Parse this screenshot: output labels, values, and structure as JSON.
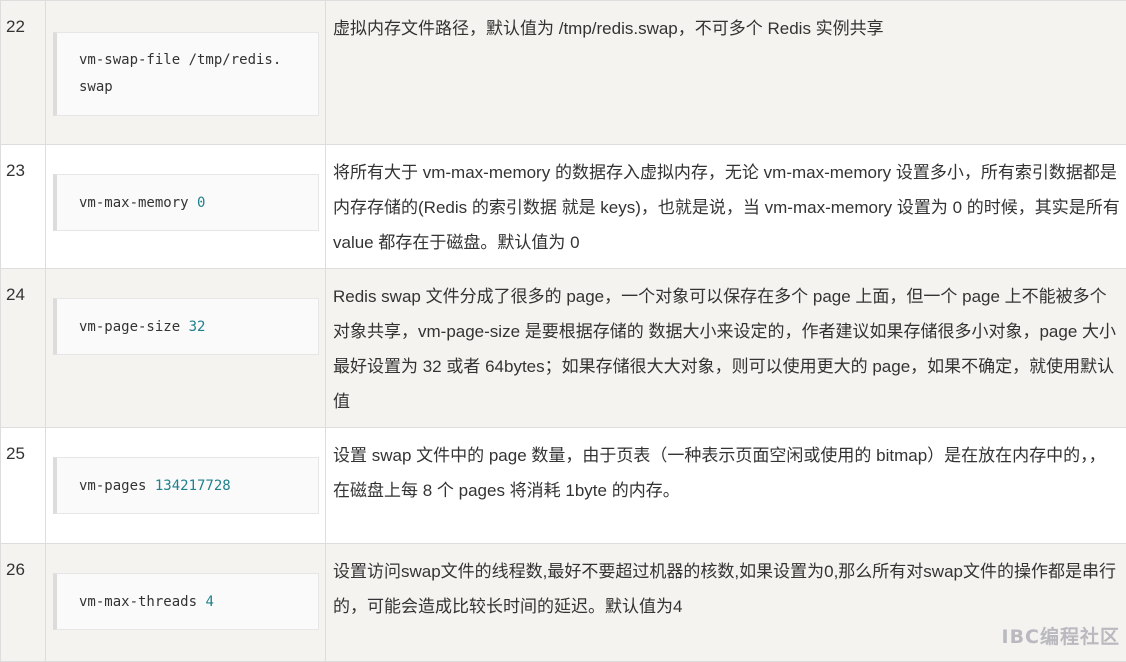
{
  "rows": [
    {
      "num": "22",
      "code_key": "vm-swap-file /tmp/redis.",
      "code_key_line2": "swap",
      "code_val": "",
      "desc": "虚拟内存文件路径，默认值为 /tmp/redis.swap，不可多个 Redis 实例共享"
    },
    {
      "num": "23",
      "code_key": "vm-max-memory ",
      "code_val": "0",
      "desc": "将所有大于 vm-max-memory 的数据存入虚拟内存，无论 vm-max-memory 设置多小，所有索引数据都是内存存储的(Redis 的索引数据 就是 keys)，也就是说，当 vm-max-memory 设置为 0 的时候，其实是所有 value 都存在于磁盘。默认值为 0"
    },
    {
      "num": "24",
      "code_key": "vm-page-size ",
      "code_val": "32",
      "desc": "Redis swap 文件分成了很多的 page，一个对象可以保存在多个 page 上面，但一个 page 上不能被多个对象共享，vm-page-size 是要根据存储的 数据大小来设定的，作者建议如果存储很多小对象，page 大小最好设置为 32 或者 64bytes；如果存储很大大对象，则可以使用更大的 page，如果不确定，就使用默认值"
    },
    {
      "num": "25",
      "code_key": "vm-pages ",
      "code_val": "134217728",
      "desc": "设置 swap 文件中的 page 数量，由于页表（一种表示页面空闲或使用的 bitmap）是在放在内存中的，，在磁盘上每 8 个 pages 将消耗 1byte 的内存。"
    },
    {
      "num": "26",
      "code_key": "vm-max-threads ",
      "code_val": "4",
      "desc": "设置访问swap文件的线程数,最好不要超过机器的核数,如果设置为0,那么所有对swap文件的操作都是串行的，可能会造成比较长时间的延迟。默认值为4"
    }
  ],
  "watermark": "IBC编程社区"
}
